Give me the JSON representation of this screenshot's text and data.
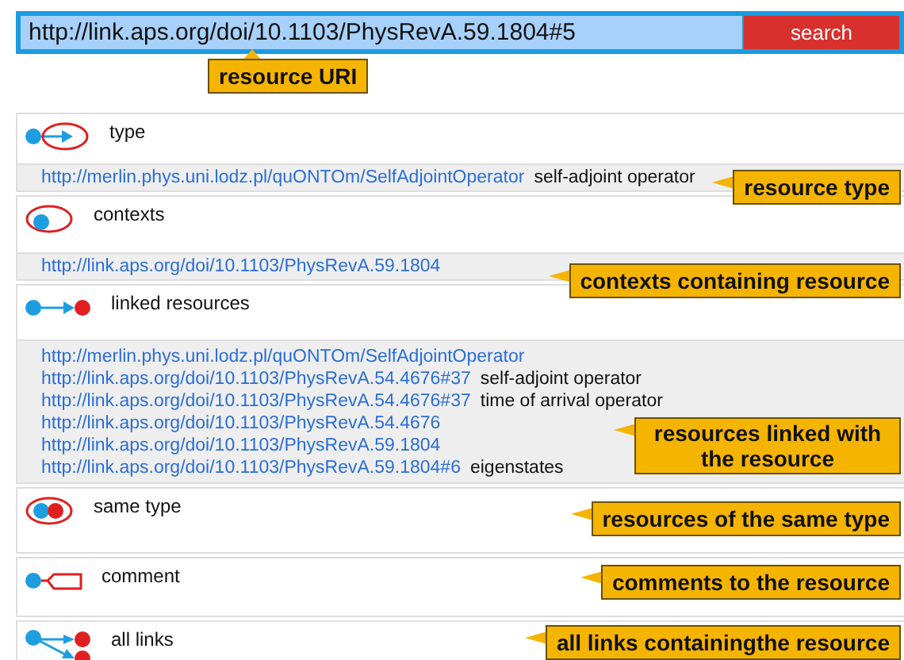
{
  "search": {
    "value": "http://link.aps.org/doi/10.1103/PhysRevA.59.1804#5",
    "button": "search",
    "callout": "resource URI"
  },
  "sections": [
    {
      "kind": "type",
      "label": "type",
      "items": [
        {
          "uri": "http://merlin.phys.uni.lodz.pl/quONTOm/SelfAdjointOperator",
          "label": "self-adjoint operator"
        }
      ],
      "callout": "resource type"
    },
    {
      "kind": "contexts",
      "label": "contexts",
      "items": [
        {
          "uri": "http://link.aps.org/doi/10.1103/PhysRevA.59.1804"
        }
      ],
      "callout": "contexts containing resource"
    },
    {
      "kind": "linked",
      "label": "linked resources",
      "items": [
        {
          "uri": "http://merlin.phys.uni.lodz.pl/quONTOm/SelfAdjointOperator"
        },
        {
          "uri": "http://link.aps.org/doi/10.1103/PhysRevA.54.4676#37",
          "label": "self-adjoint operator"
        },
        {
          "uri": "http://link.aps.org/doi/10.1103/PhysRevA.54.4676#37",
          "label": "time of arrival operator"
        },
        {
          "uri": "http://link.aps.org/doi/10.1103/PhysRevA.54.4676"
        },
        {
          "uri": "http://link.aps.org/doi/10.1103/PhysRevA.59.1804"
        },
        {
          "uri": "http://link.aps.org/doi/10.1103/PhysRevA.59.1804#6",
          "label": "eigenstates"
        }
      ],
      "callout": "resources linked with the resource"
    },
    {
      "kind": "same_type",
      "label": "same type",
      "callout": "resources of the same type"
    },
    {
      "kind": "comment",
      "label": "comment",
      "callout": "comments to the resource"
    },
    {
      "kind": "all_links",
      "label": "all links",
      "callout": "all links containingthe resource"
    }
  ]
}
